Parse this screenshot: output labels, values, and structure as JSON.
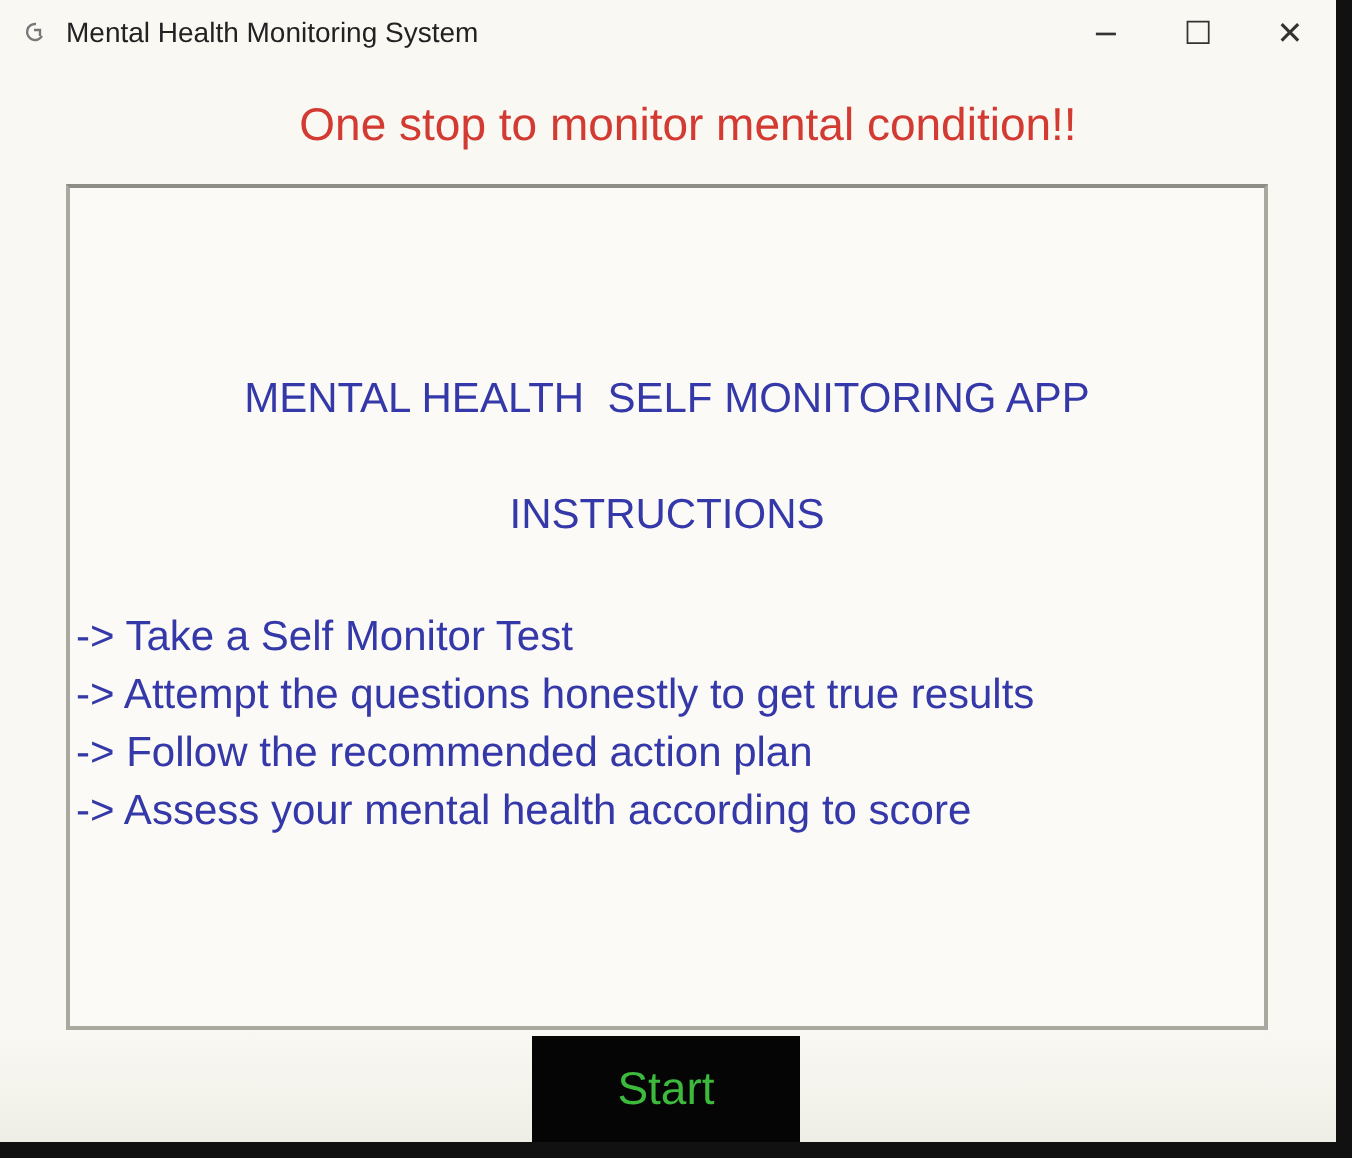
{
  "window": {
    "title": "Mental Health Monitoring System",
    "controls": [
      "−",
      "☐",
      "✕"
    ]
  },
  "tagline": "One stop to monitor mental condition!!",
  "panel": {
    "heading": "MENTAL HEALTH  SELF MONITORING APP",
    "subheading": "INSTRUCTIONS",
    "steps": [
      "-> Take a Self Monitor Test",
      "-> Attempt the questions honestly to get true results",
      "-> Follow the recommended action plan",
      "-> Assess your mental health according to score"
    ]
  },
  "button": "Start"
}
